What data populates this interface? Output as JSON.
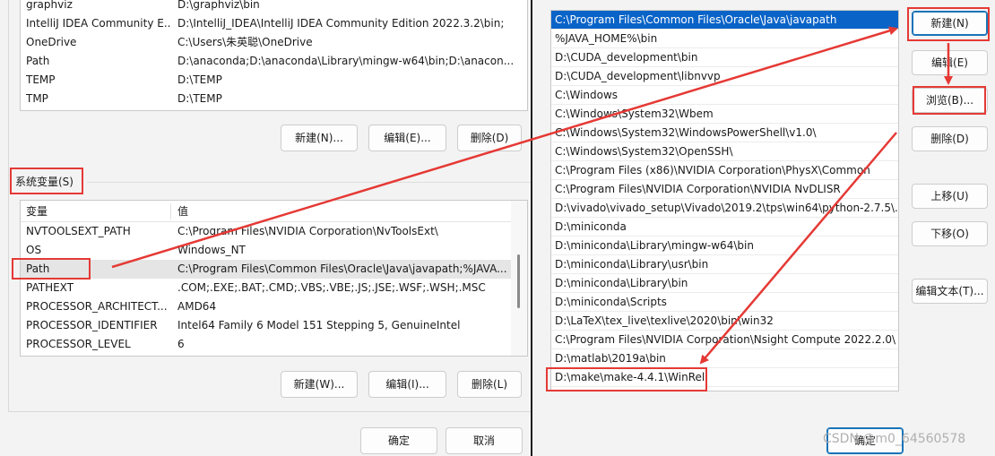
{
  "user_vars": {
    "rows": [
      {
        "name": "graphviz",
        "value": "D:\\graphviz\\bin"
      },
      {
        "name": "IntelliJ IDEA Community E...",
        "value": "D:\\IntelliJ_IDEA\\IntelliJ IDEA Community Edition 2022.3.2\\bin;"
      },
      {
        "name": "OneDrive",
        "value": "C:\\Users\\朱英聪\\OneDrive"
      },
      {
        "name": "Path",
        "value": "D:\\anaconda;D:\\anaconda\\Library\\mingw-w64\\bin;D:\\anacon..."
      },
      {
        "name": "TEMP",
        "value": "D:\\TEMP"
      },
      {
        "name": "TMP",
        "value": "D:\\TEMP"
      }
    ],
    "buttons": {
      "new": "新建(N)...",
      "edit": "编辑(E)...",
      "delete": "删除(D)"
    }
  },
  "system_vars": {
    "label": "系统变量(S)",
    "header": {
      "name": "变量",
      "value": "值"
    },
    "rows": [
      {
        "name": "NVTOOLSEXT_PATH",
        "value": "C:\\Program Files\\NVIDIA Corporation\\NvToolsExt\\"
      },
      {
        "name": "OS",
        "value": "Windows_NT"
      },
      {
        "name": "Path",
        "value": "C:\\Program Files\\Common Files\\Oracle\\Java\\javapath;%JAVA..."
      },
      {
        "name": "PATHEXT",
        "value": ".COM;.EXE;.BAT;.CMD;.VBS;.VBE;.JS;.JSE;.WSF;.WSH;.MSC"
      },
      {
        "name": "PROCESSOR_ARCHITECT...",
        "value": "AMD64"
      },
      {
        "name": "PROCESSOR_IDENTIFIER",
        "value": "Intel64 Family 6 Model 151 Stepping 5, GenuineIntel"
      },
      {
        "name": "PROCESSOR_LEVEL",
        "value": "6"
      }
    ],
    "buttons": {
      "new": "新建(W)...",
      "edit": "编辑(I)...",
      "delete": "删除(L)"
    }
  },
  "left_footer": {
    "ok": "确定",
    "cancel": "取消"
  },
  "path_editor": {
    "entries": [
      "C:\\Program Files\\Common Files\\Oracle\\Java\\javapath",
      "%JAVA_HOME%\\bin",
      "D:\\CUDA_development\\bin",
      "D:\\CUDA_development\\libnvvp",
      "C:\\Windows",
      "C:\\Windows\\System32\\Wbem",
      "C:\\Windows\\System32\\WindowsPowerShell\\v1.0\\",
      "C:\\Windows\\System32\\OpenSSH\\",
      "C:\\Program Files (x86)\\NVIDIA Corporation\\PhysX\\Common",
      "C:\\Program Files\\NVIDIA Corporation\\NVIDIA NvDLISR",
      "D:\\vivado\\vivado_setup\\Vivado\\2019.2\\tps\\win64\\python-2.7.5\\...",
      "D:\\miniconda",
      "D:\\miniconda\\Library\\mingw-w64\\bin",
      "D:\\miniconda\\Library\\usr\\bin",
      "D:\\miniconda\\Library\\bin",
      "D:\\miniconda\\Scripts",
      "D:\\LaTeX\\tex_live\\texlive\\2020\\bin\\win32",
      "C:\\Program Files\\NVIDIA Corporation\\Nsight Compute 2022.2.0\\",
      "D:\\matlab\\2019a\\bin",
      "D:\\make\\make-4.4.1\\WinRel"
    ],
    "buttons": {
      "new": "新建(N)",
      "edit": "编辑(E)",
      "browse": "浏览(B)...",
      "delete": "删除(D)",
      "move_up": "上移(U)",
      "move_down": "下移(O)",
      "edit_text": "编辑文本(T)..."
    },
    "ok": "确定"
  },
  "watermark": "CSDN @m0_64560578",
  "colors": {
    "highlight": "#e53935",
    "selection": "#0a64c8"
  }
}
